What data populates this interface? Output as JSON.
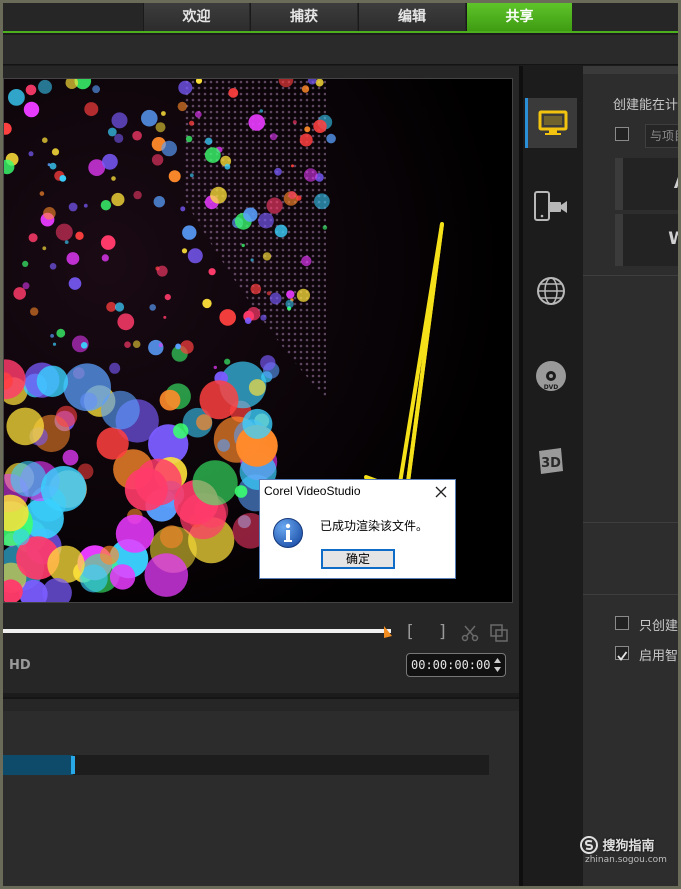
{
  "nav": {
    "tabs": [
      {
        "label": "欢迎",
        "active": false
      },
      {
        "label": "捕获",
        "active": false
      },
      {
        "label": "编辑",
        "active": false
      },
      {
        "label": "共享",
        "active": true
      }
    ],
    "accent_color": "#4caf1e"
  },
  "preview": {
    "hd_label": "HD",
    "mark_in_label": "[",
    "mark_out_label": "]",
    "timecode": "00:00:00:00",
    "scrub_position_fraction": 0.76
  },
  "timeline": {
    "render_progress_fraction": 0.145
  },
  "side_icons": [
    {
      "name": "computer-icon",
      "active": true
    },
    {
      "name": "mobile-device-icon",
      "active": false
    },
    {
      "name": "web-globe-icon",
      "active": false
    },
    {
      "name": "disc-dvd-icon",
      "active": false
    },
    {
      "name": "3d-icon",
      "active": false
    }
  ],
  "options": {
    "heading": "创建能在计",
    "project_option_placeholder": "与项目",
    "preset_letter_1": "A",
    "preset_letter_2": "W",
    "only_create_label": "只创建",
    "enable_smart_label": "启用智",
    "enable_smart_checked": true,
    "only_create_checked": false
  },
  "dialog": {
    "title": "Corel VideoStudio",
    "message": "已成功渲染该文件。",
    "ok_label": "确定"
  },
  "watermark": {
    "brand": "搜狗指南",
    "url": "zhinan.sogou.com"
  }
}
